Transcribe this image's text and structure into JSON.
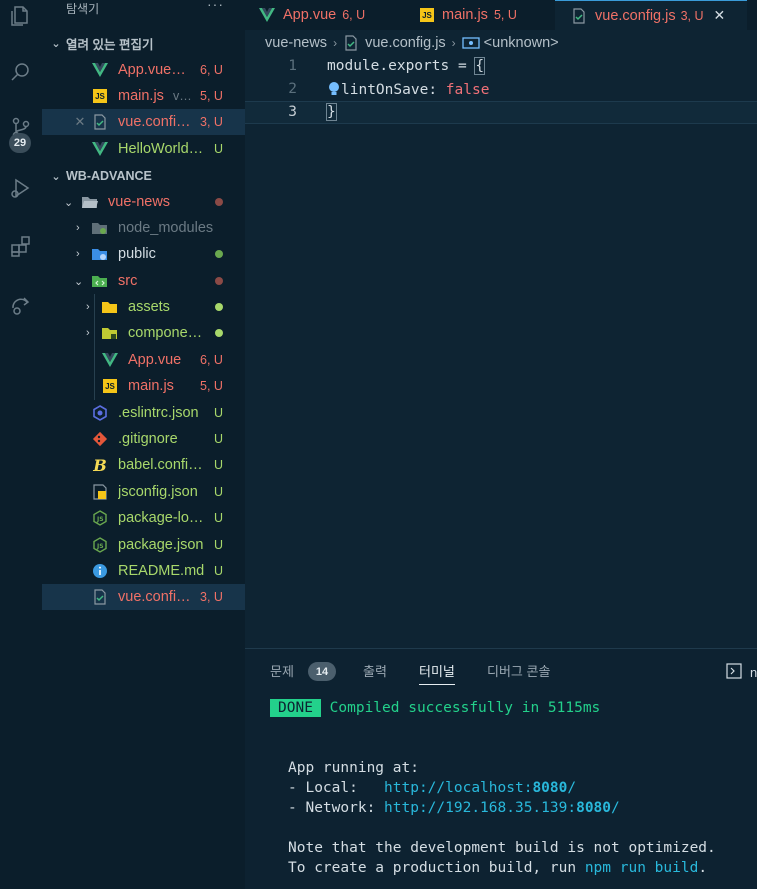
{
  "sidebar": {
    "title": "탐색기",
    "more": "···",
    "open_editors_header": "열려 있는 편집기",
    "open_editors": [
      {
        "name": "App.vue",
        "display": "App.vue…",
        "status": "6, U",
        "type": "vue"
      },
      {
        "name": "main.js",
        "display": "main.js",
        "suffix": "v…",
        "status": "5, U",
        "type": "js"
      },
      {
        "name": "vue.config.js",
        "display": "vue.confi…",
        "status": "3, U",
        "type": "config",
        "close": "✕"
      },
      {
        "name": "HelloWorld.vue",
        "display": "HelloWorld…",
        "status": "U",
        "type": "vue"
      }
    ],
    "workspace_header": "WB-ADVANCE",
    "tree": [
      {
        "name": "vue-news"
      },
      {
        "name": "node_modules"
      },
      {
        "name": "public"
      },
      {
        "name": "src"
      },
      {
        "name": "assets"
      },
      {
        "name": "compone…"
      },
      {
        "name": "App.vue",
        "status": "6, U"
      },
      {
        "name": "main.js",
        "status": "5, U"
      },
      {
        "name": ".eslintrc.json",
        "status": "U"
      },
      {
        "name": ".gitignore",
        "status": "U"
      },
      {
        "name": "babel.confi…",
        "status": "U"
      },
      {
        "name": "jsconfig.json",
        "status": "U"
      },
      {
        "name": "package-lo…",
        "status": "U"
      },
      {
        "name": "package.json",
        "status": "U"
      },
      {
        "name": "README.md",
        "status": "U"
      },
      {
        "name": "vue.confi…",
        "status": "3, U"
      }
    ]
  },
  "activity": {
    "scm_badge": "29"
  },
  "tabs": [
    {
      "label": "App.vue",
      "status": "6, U"
    },
    {
      "label": "main.js",
      "status": "5, U"
    },
    {
      "label": "vue.config.js",
      "status": "3, U",
      "close": "✕"
    }
  ],
  "breadcrumb": {
    "folder": "vue-news",
    "file": "vue.config.js",
    "symbol": "<unknown>"
  },
  "code": [
    {
      "num": "1",
      "text": "module.exports = "
    },
    {
      "num": "2",
      "key": "lintOnSave",
      "colon": ": ",
      "value": "false"
    },
    {
      "num": "3"
    }
  ],
  "panel": {
    "tabs": [
      "문제",
      "출력",
      "터미널",
      "디버그 콘솔"
    ],
    "problems_count": "14",
    "right_letter": "n",
    "terminal": {
      "done": "DONE",
      "compiled": "Compiled successfully in 5115ms",
      "running": "App running at:",
      "local_label": "- Local:   ",
      "local_url_pre": "http://localhost:",
      "local_port": "8080",
      "local_url_post": "/",
      "network_label": "- Network: ",
      "network_url_pre": "http://192.168.35.139:",
      "network_port": "8080",
      "network_url_post": "/",
      "note": "Note that the development build is not optimized.",
      "prod_pre": "To create a production build, run ",
      "prod_cmd": "npm run build",
      "prod_post": "."
    }
  },
  "colors": {
    "error": "#f07167",
    "untracked": "#a8d86b",
    "vue": "#42b883",
    "js": "#f5c518",
    "done_bg": "#23d18b"
  }
}
